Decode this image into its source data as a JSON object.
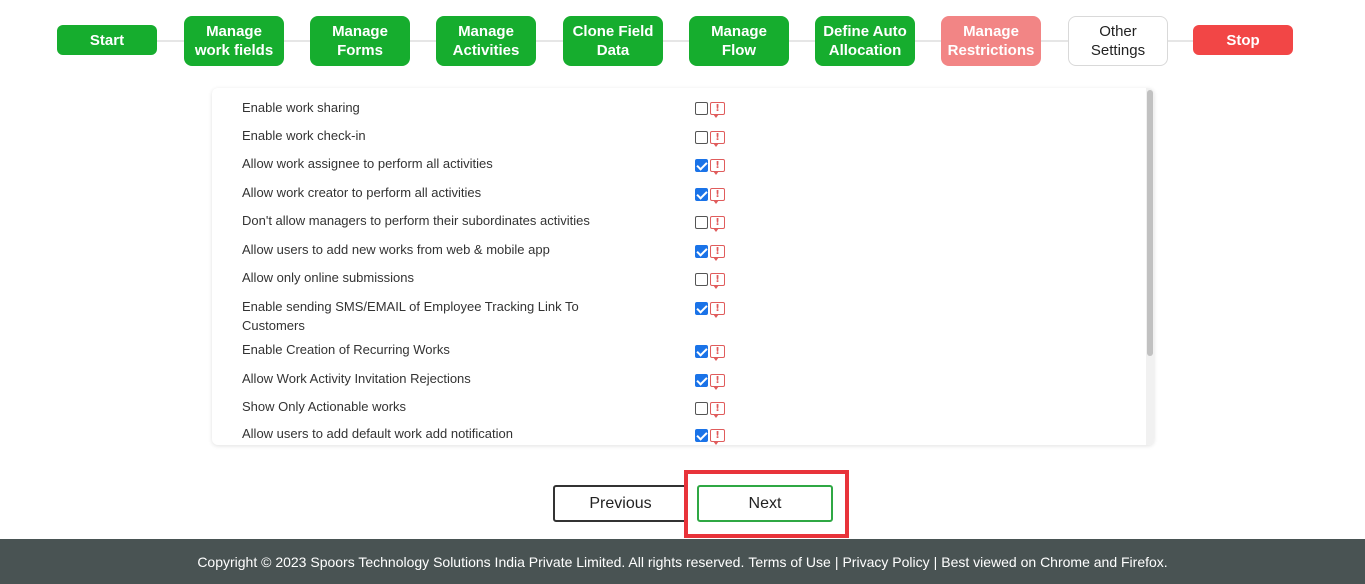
{
  "stepper": {
    "steps": [
      {
        "label": "Start"
      },
      {
        "label": "Manage\nwork fields"
      },
      {
        "label": "Manage\nForms"
      },
      {
        "label": "Manage\nActivities"
      },
      {
        "label": "Clone Field\nData"
      },
      {
        "label": "Manage\nFlow"
      },
      {
        "label": "Define Auto\nAllocation"
      },
      {
        "label": "Manage\nRestrictions"
      },
      {
        "label": "Other\nSettings"
      },
      {
        "label": "Stop"
      }
    ]
  },
  "settings": [
    {
      "label": "Enable work sharing",
      "checked": false
    },
    {
      "label": "Enable work check-in",
      "checked": false
    },
    {
      "label": "Allow work assignee to perform all activities",
      "checked": true
    },
    {
      "label": "Allow work creator to perform all activities",
      "checked": true
    },
    {
      "label": "Don't allow managers to perform their subordinates activities",
      "checked": false
    },
    {
      "label": "Allow users to add new works from web & mobile app",
      "checked": true
    },
    {
      "label": "Allow only online submissions",
      "checked": false
    },
    {
      "label": "Enable sending SMS/EMAIL of Employee Tracking Link To Customers",
      "checked": true
    },
    {
      "label": "Enable Creation of Recurring Works",
      "checked": true
    },
    {
      "label": "Allow Work Activity Invitation Rejections",
      "checked": true
    },
    {
      "label": "Show Only Actionable works",
      "checked": false
    },
    {
      "label": "Allow users to add default work add notification",
      "checked": true
    }
  ],
  "warn_glyph": "!",
  "buttons": {
    "previous": "Previous",
    "next": "Next"
  },
  "footer": {
    "copyright": "Copyright © 2023 Spoors Technology Solutions India Private Limited. All rights reserved.",
    "terms": "Terms of Use",
    "sep": "|",
    "privacy": "Privacy Policy",
    "browsers": "Best viewed on Chrome and Firefox."
  },
  "colors": {
    "step_done": "#16ad2e",
    "step_current": "#f28585",
    "step_stop": "#f24646",
    "next_border": "#2fa844",
    "highlight": "#e8333a",
    "footer_bg": "#495353"
  }
}
